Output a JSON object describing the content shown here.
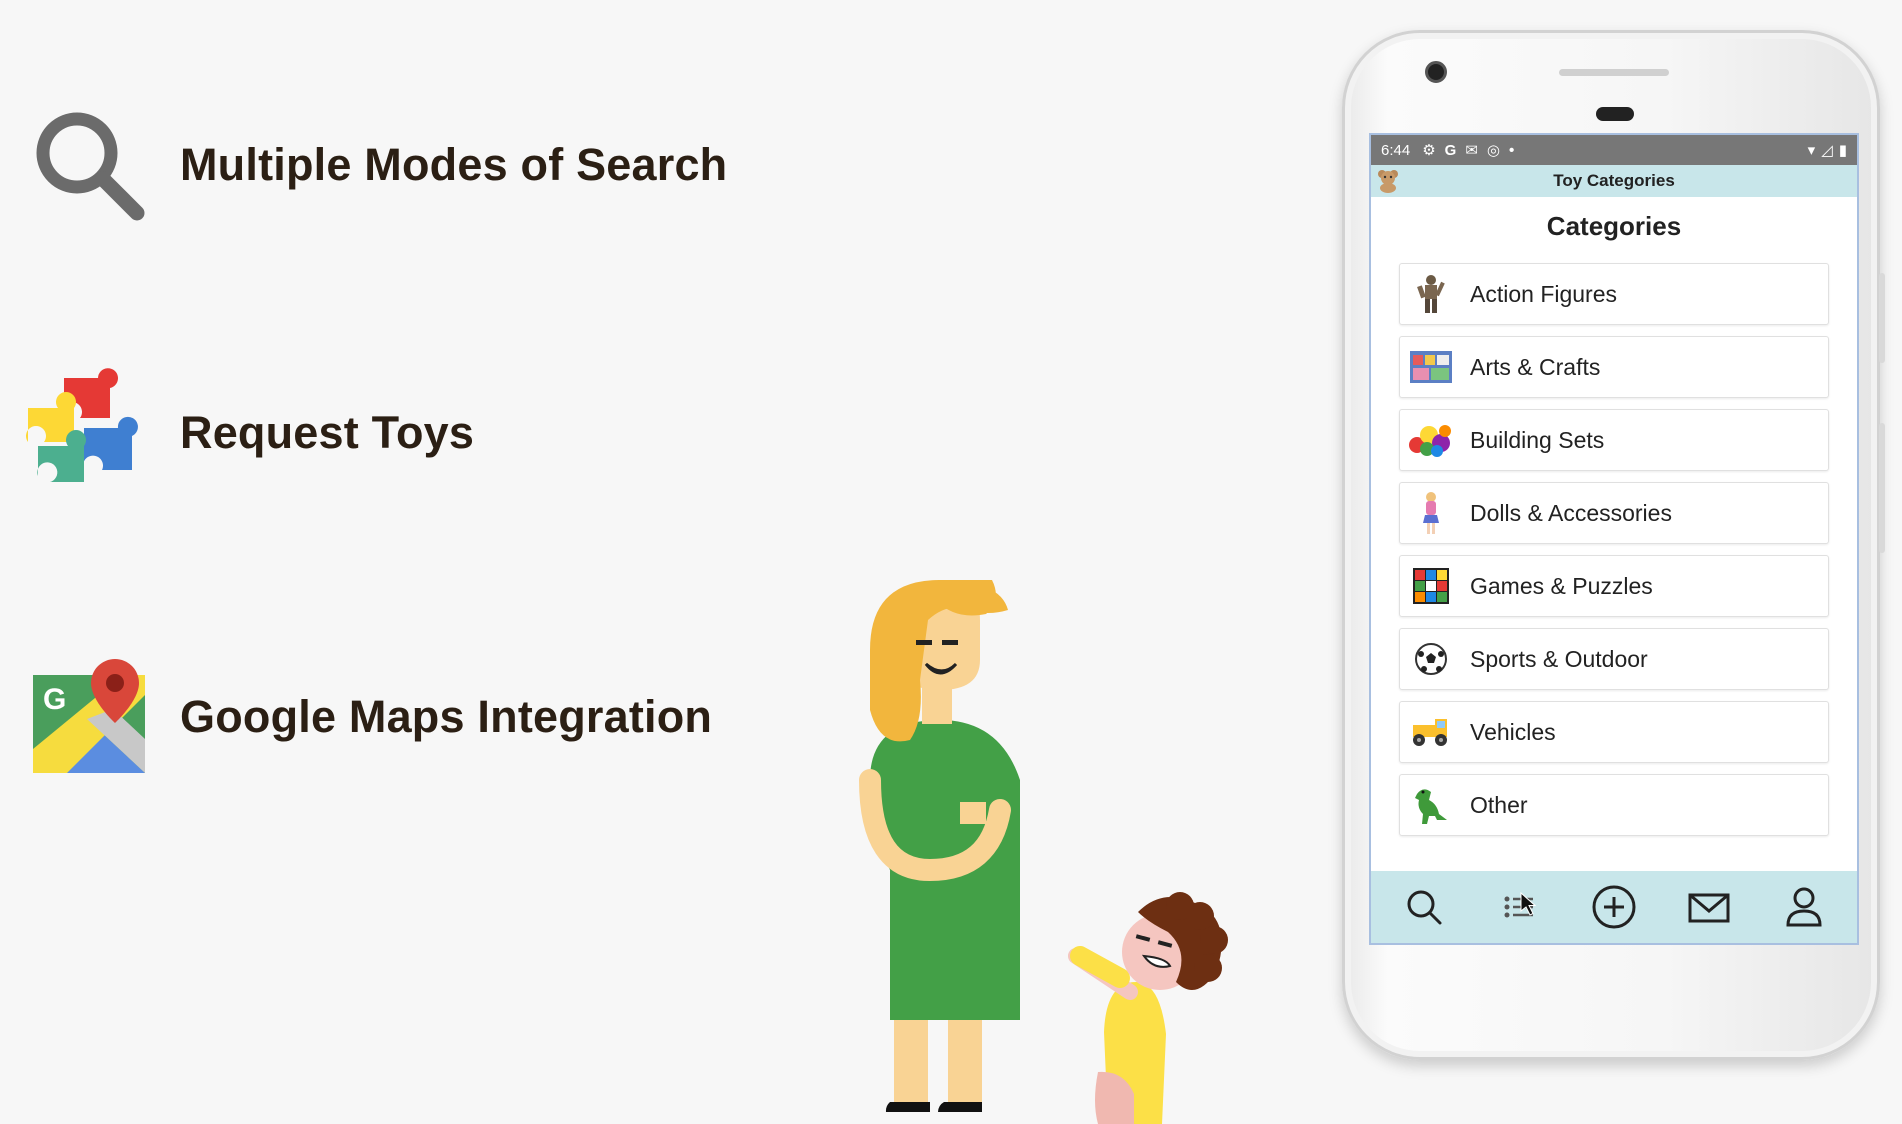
{
  "features": [
    {
      "label": "Multiple Modes of Search",
      "icon": "magnifier-icon"
    },
    {
      "label": "Request Toys",
      "icon": "puzzle-icon"
    },
    {
      "label": "Google Maps Integration",
      "icon": "google-maps-icon"
    }
  ],
  "phone": {
    "status": {
      "time": "6:44"
    },
    "appbar_title": "Toy Categories",
    "screen_title": "Categories",
    "categories": [
      {
        "label": "Action Figures",
        "icon": "action-figure-icon"
      },
      {
        "label": "Arts & Crafts",
        "icon": "arts-crafts-icon"
      },
      {
        "label": "Building Sets",
        "icon": "building-blocks-icon"
      },
      {
        "label": "Dolls & Accessories",
        "icon": "doll-icon"
      },
      {
        "label": "Games & Puzzles",
        "icon": "rubiks-cube-icon"
      },
      {
        "label": "Sports & Outdoor",
        "icon": "soccer-ball-icon"
      },
      {
        "label": "Vehicles",
        "icon": "toy-truck-icon"
      },
      {
        "label": "Other",
        "icon": "dinosaur-icon"
      }
    ],
    "nav": [
      "search-icon",
      "list-icon",
      "add-circle-icon",
      "mail-icon",
      "profile-icon"
    ]
  },
  "colors": {
    "accent_teal": "#c8e6ea",
    "dress_green": "#43a047",
    "text_dark": "#2b1f14"
  }
}
